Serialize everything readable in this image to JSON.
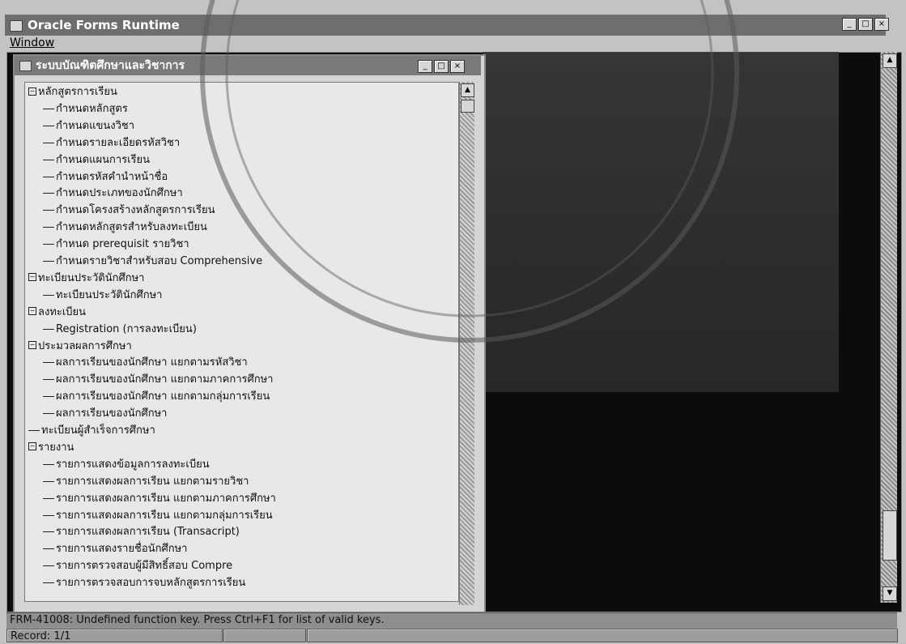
{
  "app": {
    "title": "Oracle Forms Runtime",
    "menu_window": "Window"
  },
  "child_window": {
    "title": "ระบบบัณฑิตศึกษาและวิชาการ"
  },
  "tree": [
    {
      "label": "หลักสูตรการเรียน",
      "level": 0,
      "expander": "−"
    },
    {
      "label": "กำหนดหลักสูตร",
      "level": 1
    },
    {
      "label": "กำหนดแขนงวิชา",
      "level": 1
    },
    {
      "label": "กำหนดรายละเอียดรหัสวิชา",
      "level": 1
    },
    {
      "label": "กำหนดแผนการเรียน",
      "level": 1
    },
    {
      "label": "กำหนดรหัสคำนำหน้าชื่อ",
      "level": 1
    },
    {
      "label": "กำหนดประเภทของนักศึกษา",
      "level": 1
    },
    {
      "label": "กำหนดโครงสร้างหลักสูตรการเรียน",
      "level": 1
    },
    {
      "label": "กำหนดหลักสูตรสำหรับลงทะเบียน",
      "level": 1
    },
    {
      "label": "กำหนด prerequisit รายวิชา",
      "level": 1
    },
    {
      "label": "กำหนดรายวิชาสำหรับสอบ Comprehensive",
      "level": 1
    },
    {
      "label": "ทะเบียนประวัตินักศึกษา",
      "level": 0,
      "expander": "−"
    },
    {
      "label": "ทะเบียนประวัตินักศึกษา",
      "level": 1
    },
    {
      "label": "ลงทะเบียน",
      "level": 0,
      "expander": "−"
    },
    {
      "label": "Registration (การลงทะเบียน)",
      "level": 1
    },
    {
      "label": "ประมวลผลการศึกษา",
      "level": 0,
      "expander": "−"
    },
    {
      "label": "ผลการเรียนของนักศึกษา แยกตามรหัสวิชา",
      "level": 1
    },
    {
      "label": "ผลการเรียนของนักศึกษา แยกตามภาคการศึกษา",
      "level": 1
    },
    {
      "label": "ผลการเรียนของนักศึกษา แยกตามกลุ่มการเรียน",
      "level": 1
    },
    {
      "label": "ผลการเรียนของนักศึกษา",
      "level": 1
    },
    {
      "label": "ทะเบียนผู้สำเร็จการศึกษา",
      "level": 0,
      "expander": ""
    },
    {
      "label": "รายงาน",
      "level": 0,
      "expander": "−"
    },
    {
      "label": "รายการแสดงข้อมูลการลงทะเบียน",
      "level": 1
    },
    {
      "label": "รายการแสดงผลการเรียน แยกตามรายวิชา",
      "level": 1
    },
    {
      "label": "รายการแสดงผลการเรียน แยกตามภาคการศึกษา",
      "level": 1
    },
    {
      "label": "รายการแสดงผลการเรียน แยกตามกลุ่มการเรียน",
      "level": 1
    },
    {
      "label": "รายการแสดงผลการเรียน (Transacript)",
      "level": 1
    },
    {
      "label": "รายการแสดงรายชื่อนักศึกษา",
      "level": 1
    },
    {
      "label": "รายการตรวจสอบผู้มีสิทธิ์สอบ Compre",
      "level": 1
    },
    {
      "label": "รายการตรวจสอบการจบหลักสูตรการเรียน",
      "level": 1
    }
  ],
  "status": {
    "message": "FRM-41008: Undefined function key.  Press Ctrl+F1  for list of valid keys.",
    "record": "Record: 1/1"
  },
  "icons": {
    "minimize": "minimize-icon",
    "maximize": "maximize-icon",
    "close": "close-icon"
  }
}
